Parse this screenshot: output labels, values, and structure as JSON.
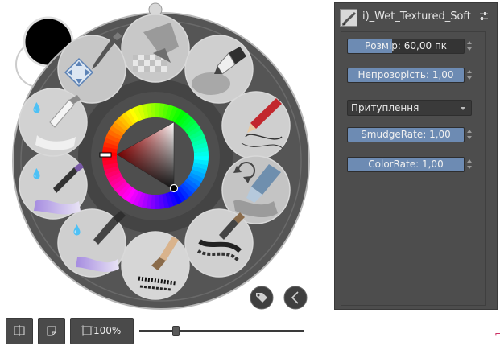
{
  "brush_editor": {
    "preset_name": "i)_Wet_Textured_Soft",
    "settings_icon": "sliders-icon",
    "size_label": "Розмір: 60,00 пк",
    "size_fraction": 0.38,
    "opacity_label": "Непрозорість: 1,00",
    "opacity_fraction": 1.0,
    "blend_mode": "Притуплення",
    "smudge_label": "SmudgeRate: 1,00",
    "smudge_fraction": 1.0,
    "color_rate_label": "ColorRate: 1,00",
    "color_rate_fraction": 1.0
  },
  "palette": {
    "foreground_color": "#000000",
    "background_color": "#ffffff",
    "ring_color": "#555555",
    "slots": [
      "airbrush-pen-brush-icon",
      "ink-pen-brush-icon",
      "pencil-brush-icon",
      "marker-blender-brush-icon",
      "bristle-brush-icon",
      "flat-brush-icon",
      "wet-bristle-brush-icon",
      "wet-watercolor-brush-icon",
      "wet-round-brush-icon",
      "pan-tool-icon"
    ],
    "tag_icon": "tag-icon",
    "back_icon": "chevron-left-icon"
  },
  "toolbar": {
    "mirror_icon": "mirror-icon",
    "canvas_icon": "canvas-icon",
    "zoom_label": "100%",
    "zoom_fraction": 0.22
  }
}
